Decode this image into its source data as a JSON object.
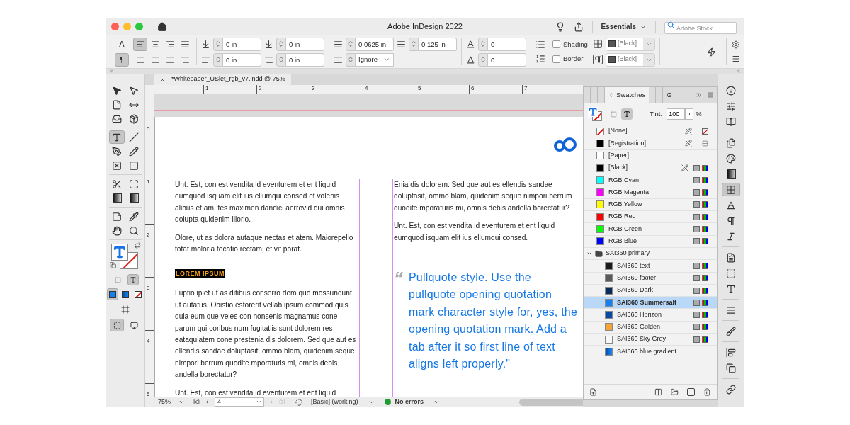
{
  "window": {
    "title": "Adobe InDesign 2022"
  },
  "title_bar": {
    "workspace": "Essentials",
    "search": {
      "placeholder": "Adobe Stock"
    }
  },
  "control_bar": {
    "modes": [
      {
        "label": "A",
        "selected": false
      },
      {
        "label": "¶",
        "selected": true
      }
    ],
    "alignment": [
      {
        "selected": true
      },
      {
        "selected": false
      },
      {
        "selected": false
      },
      {
        "selected": false
      },
      {
        "selected": false
      },
      {
        "selected": false
      },
      {
        "selected": false
      },
      {
        "selected": false
      }
    ],
    "indents": [
      {
        "value": "0 in"
      },
      {
        "value": "0 in"
      },
      {
        "value": "0 in"
      },
      {
        "value": "0 in"
      }
    ],
    "space_before": {
      "value": "0.0625 in"
    },
    "space_after": {
      "value": "0.125 in"
    },
    "align_to_grid": {
      "value": "Ignore"
    },
    "drop_cap": [
      {
        "value": "0"
      },
      {
        "value": "0"
      }
    ],
    "options": [
      {
        "label": "Shading",
        "checked": false
      },
      {
        "label": "Border",
        "checked": false
      }
    ],
    "colors": [
      {
        "value": "[Black]"
      },
      {
        "value": "[Black]"
      }
    ]
  },
  "toolbox": {
    "tools": [
      {
        "selected": false
      },
      {
        "selected": false
      },
      {
        "selected": false
      },
      {
        "selected": false
      },
      {
        "selected": false
      },
      {
        "selected": false
      },
      {
        "selected": true
      },
      {
        "selected": false
      },
      {
        "selected": false
      },
      {
        "selected": false
      },
      {
        "selected": false
      },
      {
        "selected": false
      },
      {
        "selected": false
      },
      {
        "selected": false
      },
      {
        "selected": false
      },
      {
        "selected": false
      },
      {
        "selected": false
      },
      {
        "selected": false
      },
      {
        "selected": false
      },
      {
        "selected": false
      }
    ],
    "formatting": [
      {
        "selected": false
      },
      {
        "selected": true
      }
    ],
    "apply": [
      {
        "selected": true
      },
      {
        "selected": false
      },
      {
        "selected": false
      }
    ],
    "view_modes": [
      {
        "selected": true
      },
      {
        "selected": false
      }
    ]
  },
  "document": {
    "tab": "*Whitepaper_USlet_rgb_v7.indd @ 75%",
    "ruler_h": [
      "1",
      "2",
      "3",
      "4",
      "5",
      "6",
      "7"
    ],
    "ruler_v": [
      "0",
      "1",
      "2",
      "3",
      "4",
      "5"
    ],
    "columns": [
      [
        {
          "kind": "body",
          "text": "Unt. Est, con est vendita id eventurem et ent liquid eumquod isquam elit ius ellumqui consed et volenis alibus et am, tes maximen dandici aerrovid qui omnis dolupta quidenim illorio."
        },
        {
          "kind": "body",
          "text": "Olore, ut as dolora autaque nectas et atem. Maiorepello totat moloria tecatio rectam, et vit porat."
        },
        {
          "kind": "heading",
          "text": "LOREM IPSUM"
        },
        {
          "kind": "body",
          "text": "Luptio ipiet ut as ditibus conserro dem quo mossundunt ut autatus. Obistio estorerit vellab ipsum commod quis quia eum que veles con nonsenis magnamus cone parum qui coribus num fugitatiis sunt dolorem res eataquiatem cone prestenia dis dolorem. Sed que aut es ellendis sandae doluptasit, ommo blam, quidenim seque nimpori berrum quodite mporaturis mi, omnis debis andella borectatur?"
        },
        {
          "kind": "body",
          "text": "Unt. Est, con est vendita id eventurem et ent liquid"
        }
      ],
      [
        {
          "kind": "body",
          "text": "Enia dis dolorem. Sed que aut es ellendis sandae doluptasit, ommo blam, quidenim seque nimpori berrum quodite mporaturis mi, omnis debis andella borectatur?"
        },
        {
          "kind": "body",
          "text": "Unt. Est, con est vendita id eventurem et ent liquid eumquod isquam elit ius ellumqui consed."
        },
        {
          "kind": "pullquote",
          "mark": "“",
          "text": "Pullquote style. Use the pullquote opening quotation mark character style for, yes, the opening quotation mark. Add a tab after it so first line of text aligns left properly.\""
        }
      ]
    ]
  },
  "status_bar": {
    "zoom": "75%",
    "page": "4",
    "profile": "[Basic] (working)",
    "preflight": "No errors"
  },
  "swatches_panel": {
    "tabs": [
      {
        "label": "Swatches",
        "selected": true
      },
      {
        "label": "G",
        "selected": false
      }
    ],
    "tint": {
      "label": "Tint:",
      "value": "100",
      "unit": "%"
    },
    "swatches": [
      {
        "name": "[None]",
        "kind": "none",
        "locked": true,
        "selected": false
      },
      {
        "name": "[Registration]",
        "kind": "registration",
        "color": "#000000",
        "locked": true,
        "selected": false
      },
      {
        "name": "[Paper]",
        "kind": "paper",
        "color": "#ffffff",
        "locked": false,
        "selected": false
      },
      {
        "name": "[Black]",
        "kind": "process",
        "color": "#000000",
        "locked": true,
        "selected": false
      },
      {
        "name": "RGB Cyan",
        "kind": "process",
        "color": "#00ffff",
        "locked": false,
        "selected": false
      },
      {
        "name": "RGB Magenta",
        "kind": "process",
        "color": "#ff00ff",
        "locked": false,
        "selected": false
      },
      {
        "name": "RGB Yellow",
        "kind": "process",
        "color": "#ffff00",
        "locked": false,
        "selected": false
      },
      {
        "name": "RGB Red",
        "kind": "process",
        "color": "#ff0000",
        "locked": false,
        "selected": false
      },
      {
        "name": "RGB Green",
        "kind": "process",
        "color": "#00ff00",
        "locked": false,
        "selected": false
      },
      {
        "name": "RGB Blue",
        "kind": "process",
        "color": "#0000ff",
        "locked": false,
        "selected": false
      },
      {
        "name": "SAI360 primary",
        "kind": "group",
        "expanded": true,
        "selected": false,
        "children": [
          {
            "name": "SAI360 text",
            "kind": "process",
            "color": "#1a1a1a",
            "locked": false,
            "selected": false
          },
          {
            "name": "SAI360 footer",
            "kind": "process",
            "color": "#5a5a5c",
            "locked": false,
            "selected": false
          },
          {
            "name": "SAI360 Dark",
            "kind": "process",
            "color": "#0b2a5c",
            "locked": false,
            "selected": false
          },
          {
            "name": "SAI360 Summersalt",
            "kind": "process",
            "color": "#1580f0",
            "locked": false,
            "selected": true
          },
          {
            "name": "SAI360 Horizon",
            "kind": "process",
            "color": "#0a4aa0",
            "locked": false,
            "selected": false
          },
          {
            "name": "SAI360 Golden",
            "kind": "process",
            "color": "#f6a43a",
            "locked": false,
            "selected": false
          },
          {
            "name": "SAI360 Sky Grey",
            "kind": "process",
            "color": "#f7f7f7",
            "locked": false,
            "selected": false
          },
          {
            "name": "SAI360 blue gradient",
            "kind": "gradient",
            "locked": false,
            "selected": false
          }
        ]
      }
    ]
  },
  "dock": [
    {
      "selected": false
    },
    {
      "selected": false
    },
    {
      "selected": false
    },
    {
      "selected": false
    },
    {
      "selected": false
    },
    {
      "selected": false
    },
    {
      "selected": true
    },
    {
      "selected": false
    },
    {
      "selected": false
    },
    {
      "selected": false
    },
    {
      "selected": false
    },
    {
      "selected": false
    },
    {
      "selected": false
    },
    {
      "selected": false
    },
    {
      "selected": false
    },
    {
      "selected": false
    },
    {
      "selected": false
    },
    {
      "selected": false
    }
  ]
}
